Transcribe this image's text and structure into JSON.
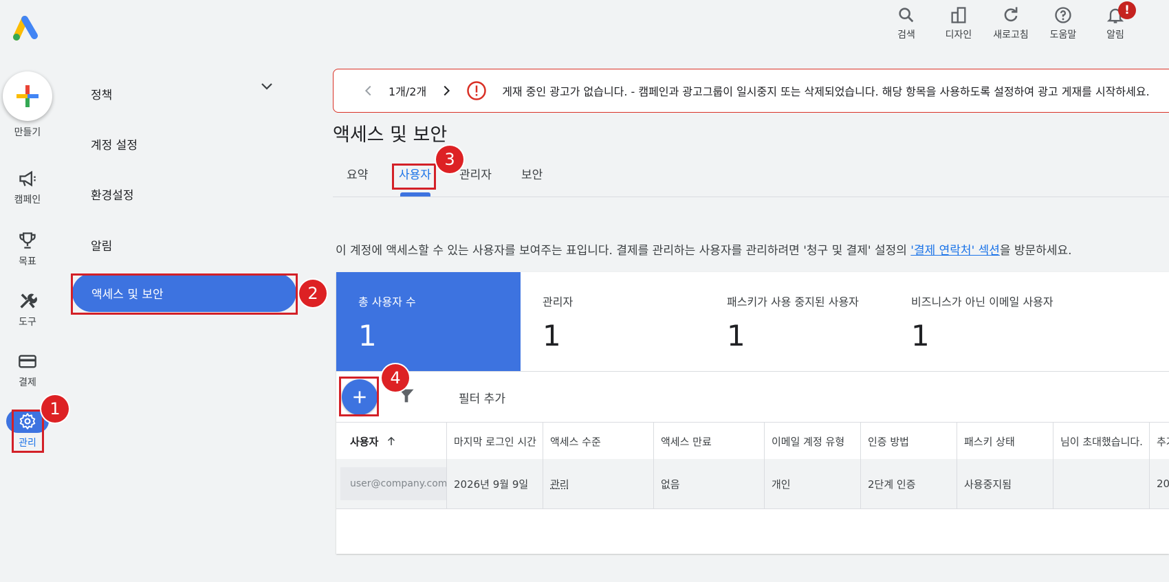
{
  "toolbar": {
    "items": [
      {
        "label": "검색",
        "icon": "search-icon"
      },
      {
        "label": "디자인",
        "icon": "design-icon"
      },
      {
        "label": "새로고침",
        "icon": "refresh-icon"
      },
      {
        "label": "도움말",
        "icon": "help-icon"
      },
      {
        "label": "알림",
        "icon": "bell-icon"
      }
    ],
    "notif_badge": "!"
  },
  "rail": {
    "create_label": "만들기",
    "items": [
      {
        "label": "캠페인",
        "icon": "megaphone-icon"
      },
      {
        "label": "목표",
        "icon": "trophy-icon"
      },
      {
        "label": "도구",
        "icon": "tools-icon"
      },
      {
        "label": "결제",
        "icon": "credit-card-icon"
      },
      {
        "label": "관리",
        "icon": "gear-icon"
      }
    ]
  },
  "subnav": {
    "items": [
      "정책",
      "계정 설정",
      "환경설정",
      "알림"
    ],
    "active": "액세스 및 보안"
  },
  "alert": {
    "pager": "1개/2개",
    "message": "게재 중인 광고가 없습니다. - 캠페인과 광고그룹이 일시중지 또는 삭제되었습니다. 해당 항목을 사용하도록 설정하여 광고 게재를 시작하세요."
  },
  "page": {
    "title": "액세스 및 보안"
  },
  "tabs": [
    "요약",
    "사용자",
    "관리자",
    "보안"
  ],
  "desc": {
    "before": "이 계정에 액세스할 수 있는 사용자를 보여주는 표입니다. 결제를 관리하는 사용자를 관리하려면 '청구 및 결제' 설정의 ",
    "link": "'결제 연락처' 섹션",
    "after": "을 방문하세요."
  },
  "stats": [
    {
      "label": "총 사용자 수",
      "value": "1"
    },
    {
      "label": "관리자",
      "value": "1"
    },
    {
      "label": "패스키가 사용 중지된 사용자",
      "value": "1"
    },
    {
      "label": "비즈니스가 아닌 이메일 사용자",
      "value": "1"
    }
  ],
  "filter": {
    "label": "필터 추가"
  },
  "table": {
    "columns": [
      "사용자",
      "마지막 로그인 시간",
      "액세스 수준",
      "액세스 만료",
      "이메일 계정 유형",
      "인증 방법",
      "패스키 상태",
      "님이 초대했습니다.",
      "추가"
    ],
    "rows": [
      [
        "user@company.com",
        "2026년 9월 9일",
        "관리",
        "없음",
        "개인",
        "2단계 인증",
        "사용중지됨",
        "",
        "20"
      ]
    ]
  },
  "callouts": [
    "1",
    "2",
    "3",
    "4"
  ],
  "colors": {
    "accent": "#3d73e0",
    "callout": "#dd2124",
    "alert_border": "#d93025"
  }
}
